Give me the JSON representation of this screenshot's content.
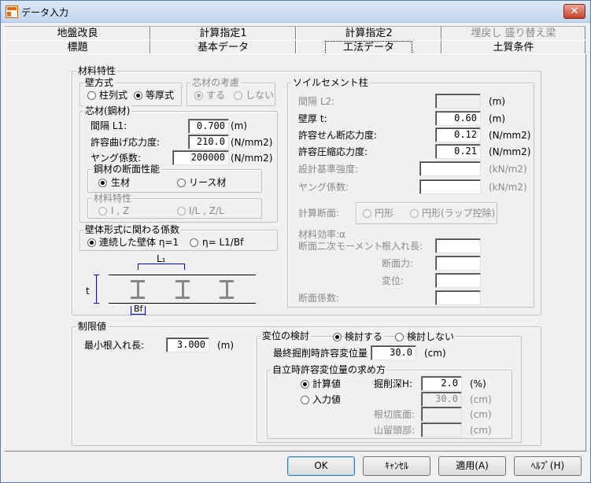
{
  "window": {
    "title": "データ入力",
    "close_label": "✕"
  },
  "tabs": {
    "row_back": [
      "地盤改良",
      "計算指定1",
      "計算指定2",
      "埋戻し 盛り替え梁"
    ],
    "row_front": [
      "標題",
      "基本データ",
      "工法データ",
      "土質条件"
    ],
    "selected": "工法データ"
  },
  "material": {
    "title": "材料特性",
    "wall_type": {
      "title": "壁方式",
      "opt1": "柱列式",
      "opt2": "等厚式",
      "selected": "等厚式"
    },
    "core_consider": {
      "title": "芯材の考慮",
      "opt1": "する",
      "opt2": "しない"
    },
    "core": {
      "title": "芯材(鋼材)",
      "spacing_label": "間隔 L1:",
      "spacing_value": "0.700",
      "spacing_unit": "(m)",
      "bend_label": "許容曲げ応力度:",
      "bend_value": "210.0",
      "bend_unit": "(N/mm2)",
      "young_label": "ヤング係数:",
      "young_value": "200000",
      "young_unit": "(N/mm2)",
      "section": {
        "title": "鋼材の断面性能",
        "opt1": "生材",
        "opt2": "リース材",
        "selected": "生材"
      },
      "mat_props": {
        "title": "材料特性",
        "opt1": "I , Z",
        "opt2": "I/L , Z/L"
      }
    },
    "wall_coef": {
      "title": "壁体形式に関わる係数",
      "opt1": "連続した壁体 η=1",
      "opt2": "η= L1/Bf",
      "selected": "連続した壁体 η=1"
    },
    "diagram": {
      "t": "t",
      "L1": "L₁",
      "Bf": "Bf"
    }
  },
  "soil_cement": {
    "title": "ソイルセメント柱",
    "spacing_label": "間隔 L2:",
    "spacing_value": "",
    "spacing_unit": "(m)",
    "thick_label": "壁厚 t:",
    "thick_value": "0.60",
    "thick_unit": "(m)",
    "shear_label": "許容せん断応力度:",
    "shear_value": "0.12",
    "shear_unit": "(N/mm2)",
    "comp_label": "許容圧縮応力度:",
    "comp_value": "0.21",
    "comp_unit": "(N/mm2)",
    "design_label": "設計基準強度:",
    "design_value": "",
    "design_unit": "(kN/m2)",
    "young_label": "ヤング係数:",
    "young_value": "",
    "young_unit": "(kN/m2)",
    "calc_section_label": "計算断面:",
    "calc_opt1": "円形",
    "calc_opt2": "円形(ラップ控除)",
    "efficiency_label": "材料効率:α",
    "moment_label": "断面二次モーメント",
    "root_label": "根入れ長:",
    "force_label": "断面力:",
    "disp_label": "変位:",
    "modulus_label": "断面係数:"
  },
  "limit": {
    "title": "制限値",
    "min_root_label": "最小根入れ長:",
    "min_root_value": "3.000",
    "min_root_unit": "(m)"
  },
  "disp_check": {
    "title": "変位の検討",
    "opt1": "検討する",
    "opt2": "検討しない",
    "selected": "検討する",
    "final_label": "最終掘削時許容変位量",
    "final_value": "30.0",
    "final_unit": "(cm)",
    "self": {
      "title": "自立時許容変位量の求め方",
      "opt1": "計算値",
      "opt2": "入力値",
      "selected": "計算値",
      "depth_label": "掘削深H:",
      "depth_value": "2.0",
      "depth_unit": "(%)",
      "input_value": "30.0",
      "input_unit": "(cm)",
      "cut_label": "根切底面:",
      "cut_unit": "(cm)",
      "top_label": "山留頭部:",
      "top_unit": "(cm)"
    }
  },
  "buttons": {
    "ok": "OK",
    "cancel": "ｷｬﾝｾﾙ",
    "apply": "適用(A)",
    "help": "ﾍﾙﾌﾟ(H)"
  }
}
